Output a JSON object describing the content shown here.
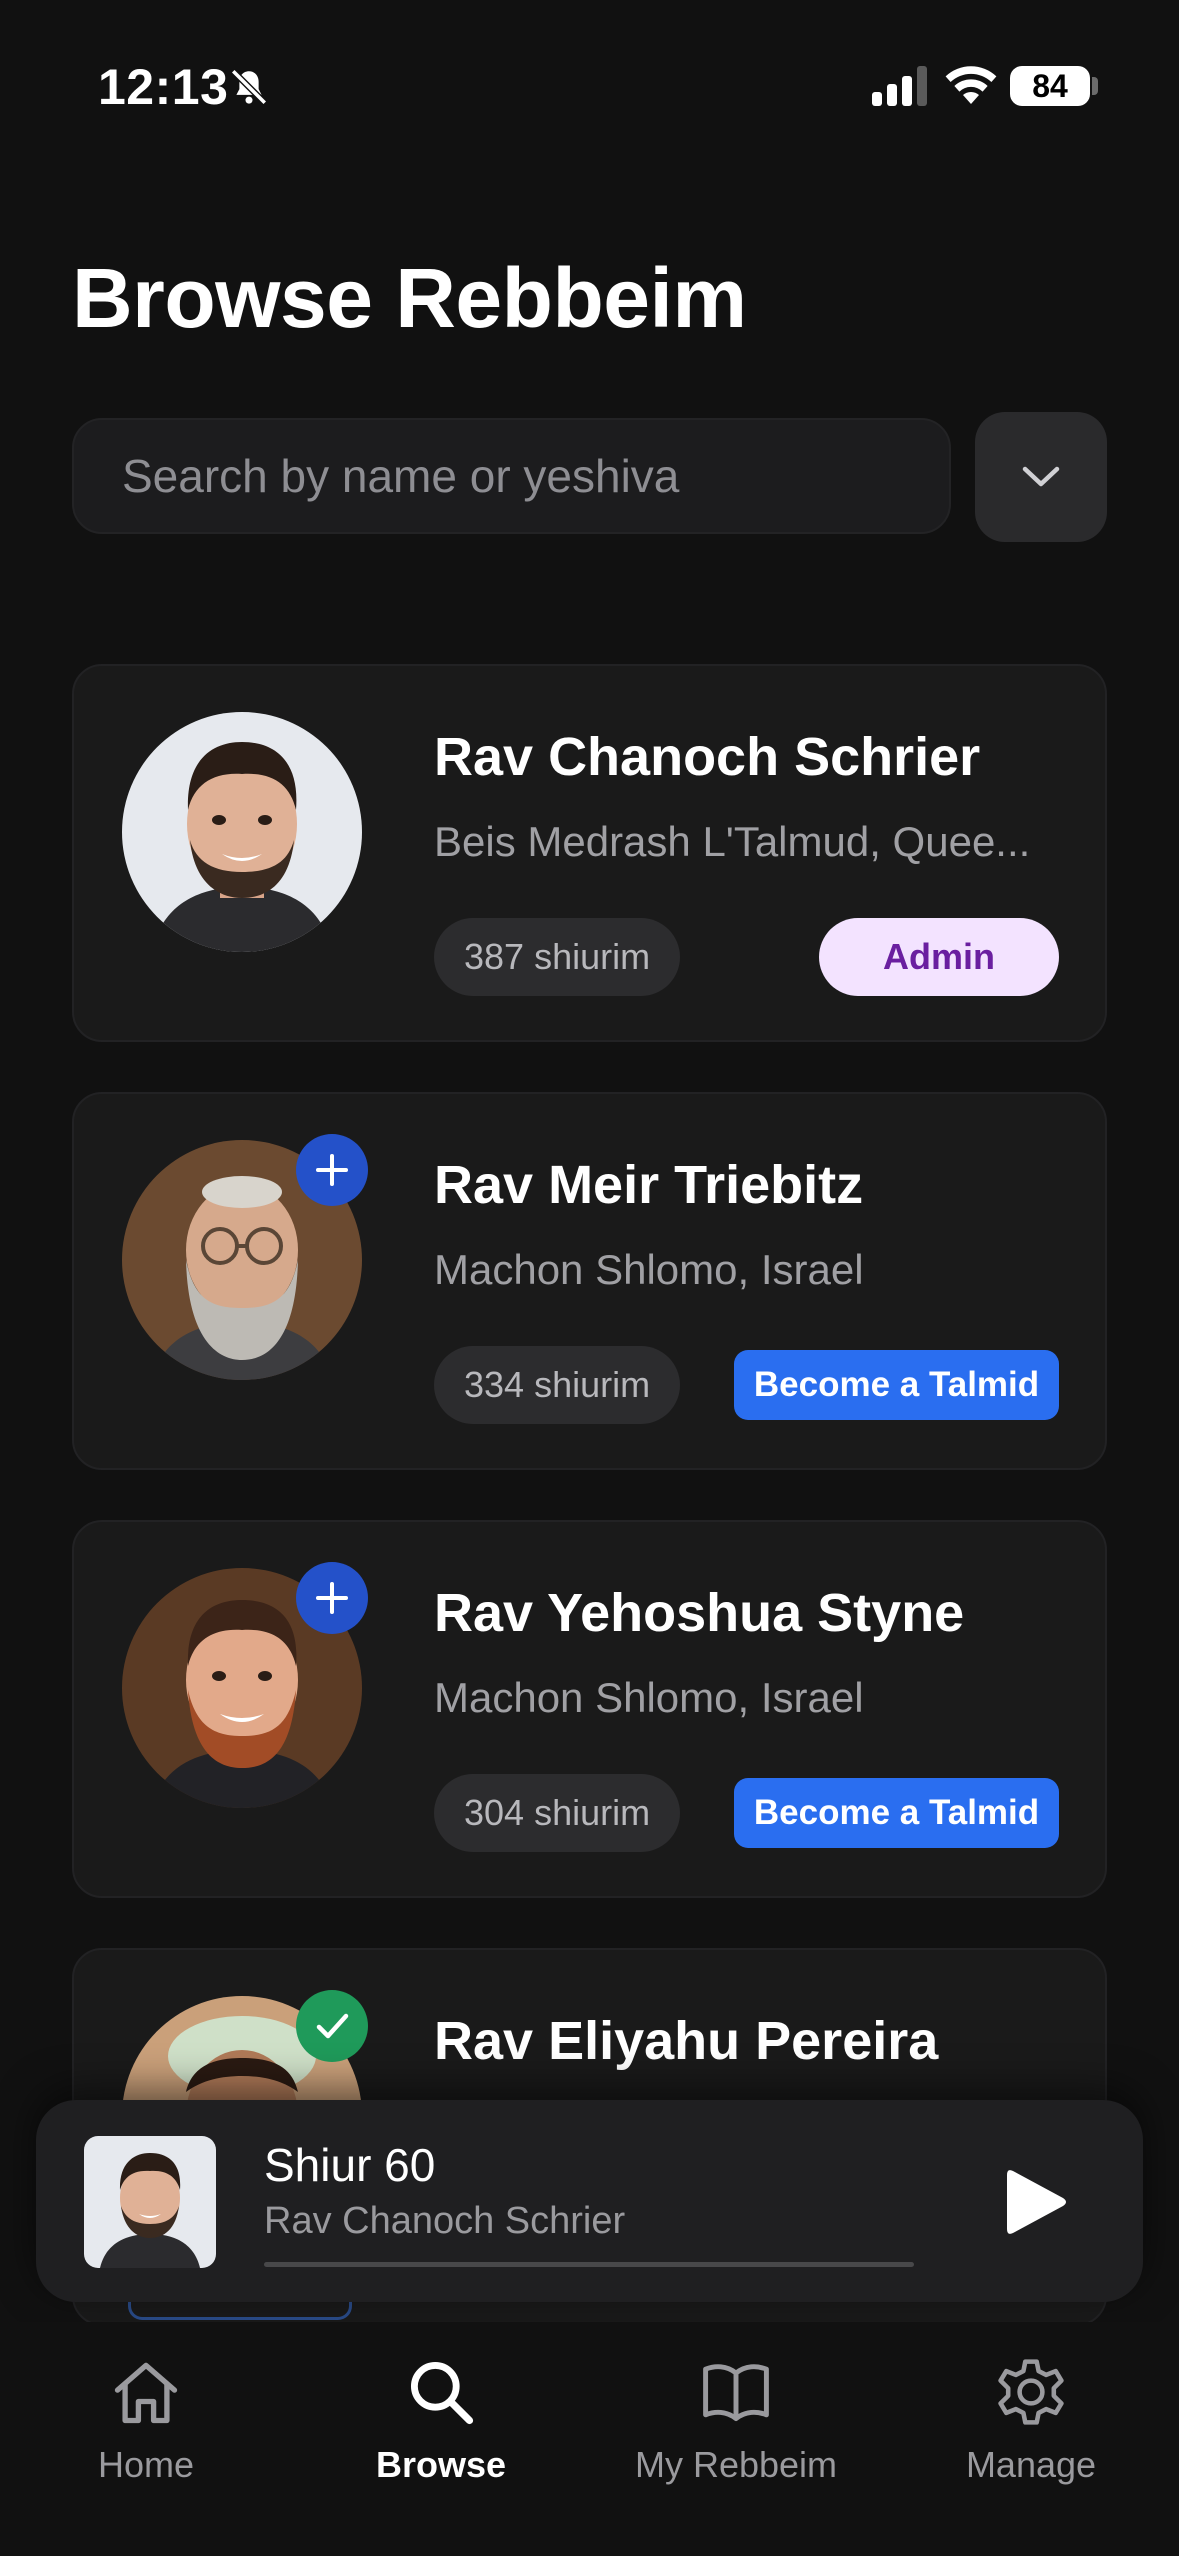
{
  "status_bar": {
    "time": "12:13",
    "battery": "84",
    "icons": [
      "bell-slash-icon",
      "cellular-signal-icon",
      "wifi-icon",
      "battery-icon"
    ]
  },
  "page": {
    "title": "Browse Rebbeim"
  },
  "search": {
    "placeholder": "Search by name or yeshiva",
    "value": "",
    "filter_icon": "chevron-down-icon"
  },
  "rebbeim": [
    {
      "name": "Rav Chanoch Schrier",
      "yeshiva": "Beis Medrash L'Talmud, Quee...",
      "shiurim": "387 shiurim",
      "action": "Admin",
      "badge": "none"
    },
    {
      "name": "Rav Meir Triebitz",
      "yeshiva": "Machon Shlomo, Israel",
      "shiurim": "334 shiurim",
      "action": "Become a Talmid",
      "badge": "plus-icon"
    },
    {
      "name": "Rav Yehoshua Styne",
      "yeshiva": "Machon Shlomo, Israel",
      "shiurim": "304 shiurim",
      "action": "Become a Talmid",
      "badge": "plus-icon"
    },
    {
      "name": "Rav Eliyahu Pereira",
      "badge": "checkmark-icon"
    }
  ],
  "mini_player": {
    "title": "Shiur 60",
    "subtitle": "Rav Chanoch Schrier",
    "progress": 0.0,
    "play_icon": "play-icon"
  },
  "tab_bar": {
    "tabs": [
      {
        "label": "Home",
        "icon": "house-icon",
        "active": false
      },
      {
        "label": "Browse",
        "icon": "search-icon",
        "active": true
      },
      {
        "label": "My Rebbeim",
        "icon": "book-open-icon",
        "active": false
      },
      {
        "label": "Manage",
        "icon": "gear-icon",
        "active": false
      }
    ]
  },
  "colors": {
    "background": "#111111",
    "card": "#1a1a1a",
    "accent_blue": "#2a6ef0",
    "admin_bg": "#f3e3ff",
    "admin_text": "#6a1fa0",
    "check_green": "#1f9a5a"
  }
}
